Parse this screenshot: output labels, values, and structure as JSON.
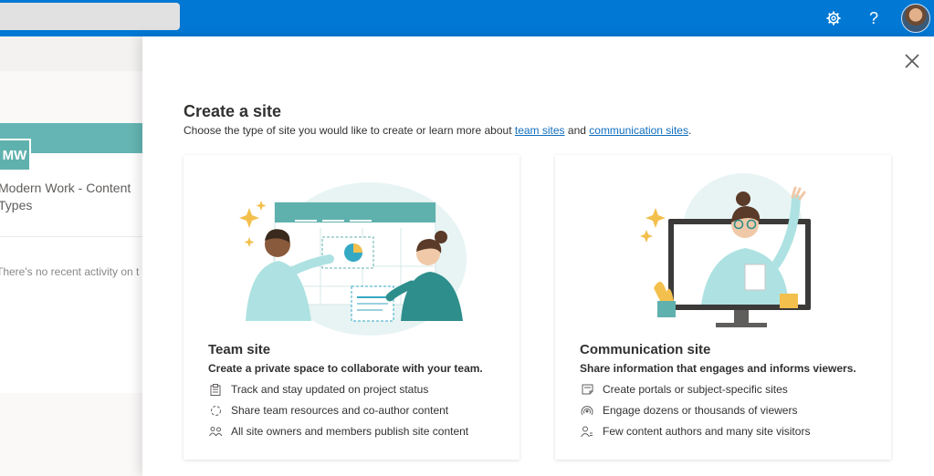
{
  "topbar": {
    "settings_icon": "gear-icon",
    "help_label": "?",
    "avatar_icon": "user-avatar"
  },
  "background_page": {
    "site_initials": "MW",
    "site_title": "Modern Work - Content\nTypes",
    "activity_text": "There's no recent activity on t"
  },
  "panel": {
    "title": "Create a site",
    "subtitle_prefix": "Choose the type of site you would like to create or learn more about ",
    "link_team": "team sites",
    "subtitle_and": " and ",
    "link_comm": "communication sites",
    "subtitle_suffix": ".",
    "close_icon": "close-icon"
  },
  "cards": [
    {
      "title": "Team site",
      "description": "Create a private space to collaborate with your team.",
      "features": [
        {
          "icon": "clipboard-icon",
          "text": "Track and stay updated on project status"
        },
        {
          "icon": "sync-icon",
          "text": "Share team resources and co-author content"
        },
        {
          "icon": "people-icon",
          "text": "All site owners and members publish site content"
        }
      ]
    },
    {
      "title": "Communication site",
      "description": "Share information that engages and informs viewers.",
      "features": [
        {
          "icon": "document-icon",
          "text": "Create portals or subject-specific sites"
        },
        {
          "icon": "broadcast-icon",
          "text": "Engage dozens or thousands of viewers"
        },
        {
          "icon": "person-icon",
          "text": "Few content authors and many site visitors"
        }
      ]
    }
  ],
  "colors": {
    "brand": "#0078d4",
    "teal": "#64b5b3",
    "link": "#106ebe"
  }
}
